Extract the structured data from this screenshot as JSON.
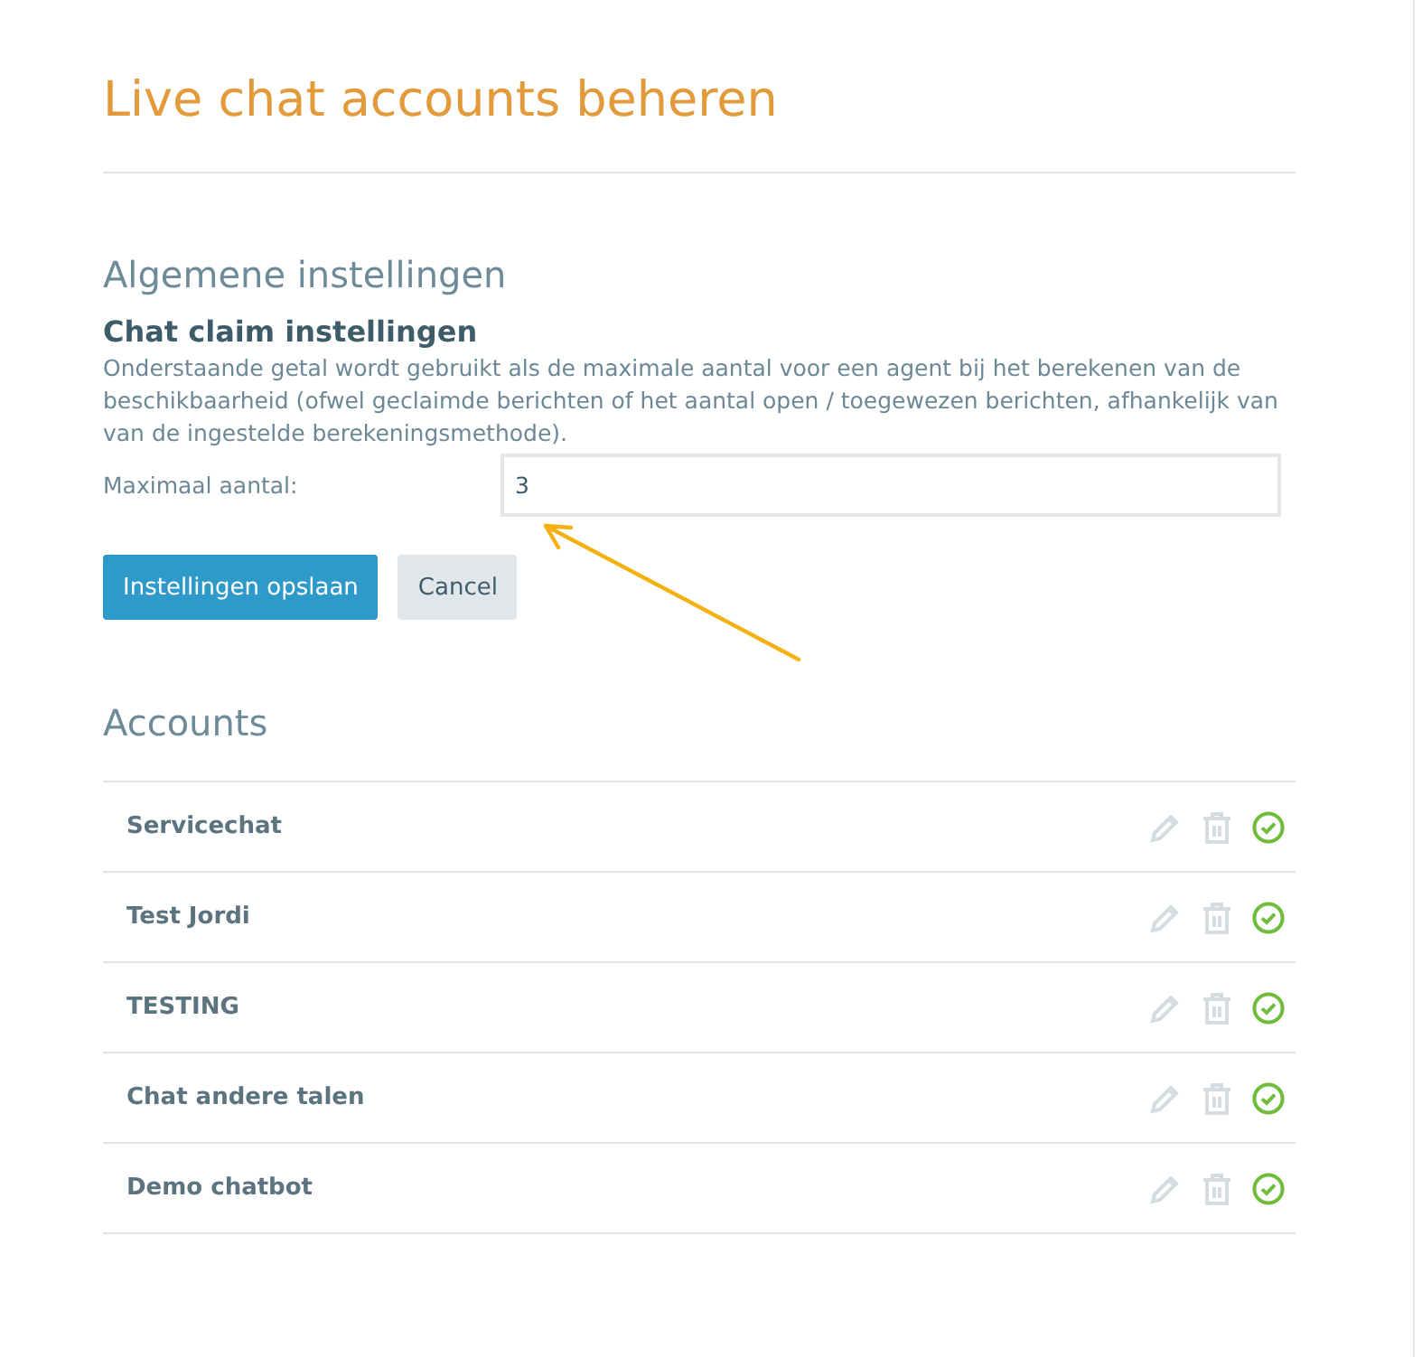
{
  "title": "Live chat accounts beheren",
  "general": {
    "heading": "Algemene instellingen",
    "subheading": "Chat claim instellingen",
    "description": "Onderstaande getal wordt gebruikt als de maximale aantal voor een agent bij het berekenen van de beschikbaarheid (ofwel geclaimde berichten of het aantal open / toegewezen berichten, afhankelijk van van de ingestelde berekeningsmethode).",
    "field_label": "Maximaal aantal:",
    "field_value": "3",
    "buttons": [
      {
        "label": "Instellingen opslaan",
        "kind": "primary"
      },
      {
        "label": "Cancel",
        "kind": "secondary"
      }
    ]
  },
  "accounts": {
    "heading": "Accounts",
    "rows": [
      {
        "name": "Servicechat",
        "active": true
      },
      {
        "name": "Test Jordi",
        "active": true
      },
      {
        "name": "TESTING",
        "active": true
      },
      {
        "name": "Chat andere talen",
        "active": true
      },
      {
        "name": "Demo chatbot",
        "active": true
      }
    ]
  }
}
